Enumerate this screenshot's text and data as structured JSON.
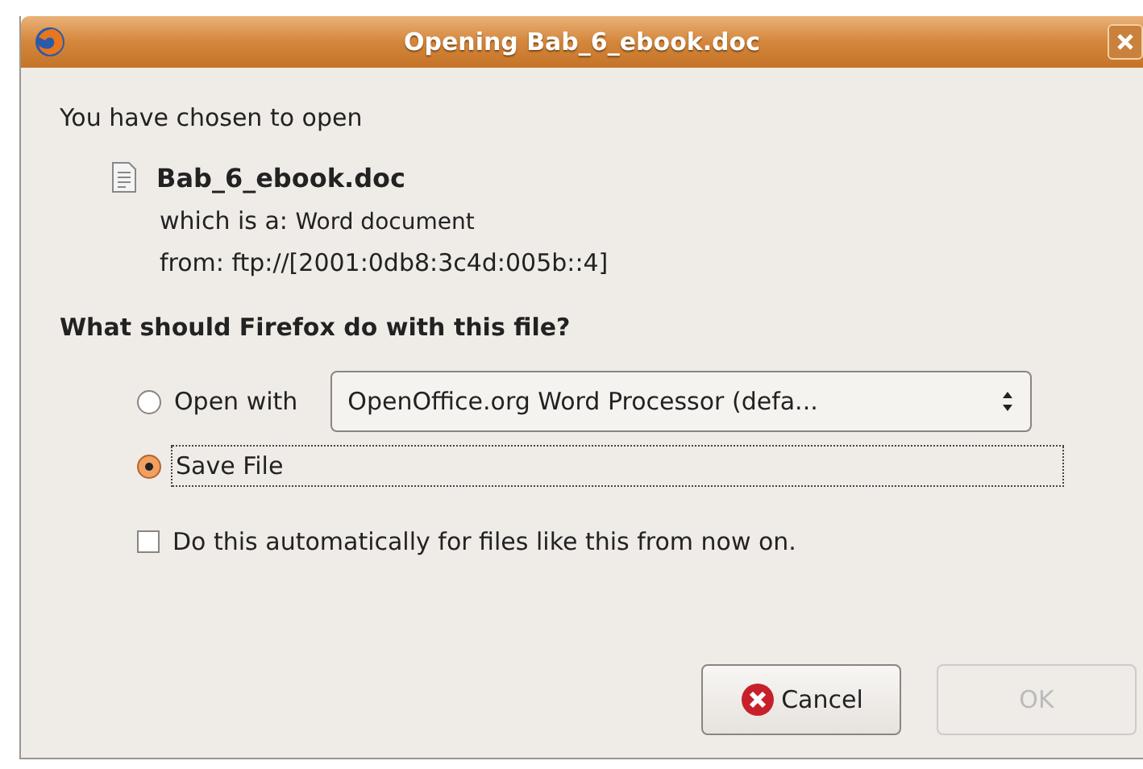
{
  "window": {
    "title": "Opening Bab_6_ebook.doc"
  },
  "intro": "You have chosen to open",
  "file": {
    "name": "Bab_6_ebook.doc",
    "type_label": "which is a:",
    "type": "Word document",
    "source": "from: ftp://[2001:0db8:3c4d:005b::4]"
  },
  "question": "What should Firefox do with this file?",
  "options": [
    {
      "kind": "open",
      "label": "Open with",
      "selected": false,
      "app": "OpenOffice.org Word Processor (defa..."
    },
    {
      "kind": "save",
      "label": "Save File",
      "selected": true
    }
  ],
  "auto": {
    "label": "Do this automatically for files like this from now on.",
    "checked": false
  },
  "buttons": [
    {
      "kind": "cancel",
      "label": "Cancel",
      "disabled": false
    },
    {
      "kind": "ok",
      "label": "OK",
      "disabled": true
    }
  ]
}
